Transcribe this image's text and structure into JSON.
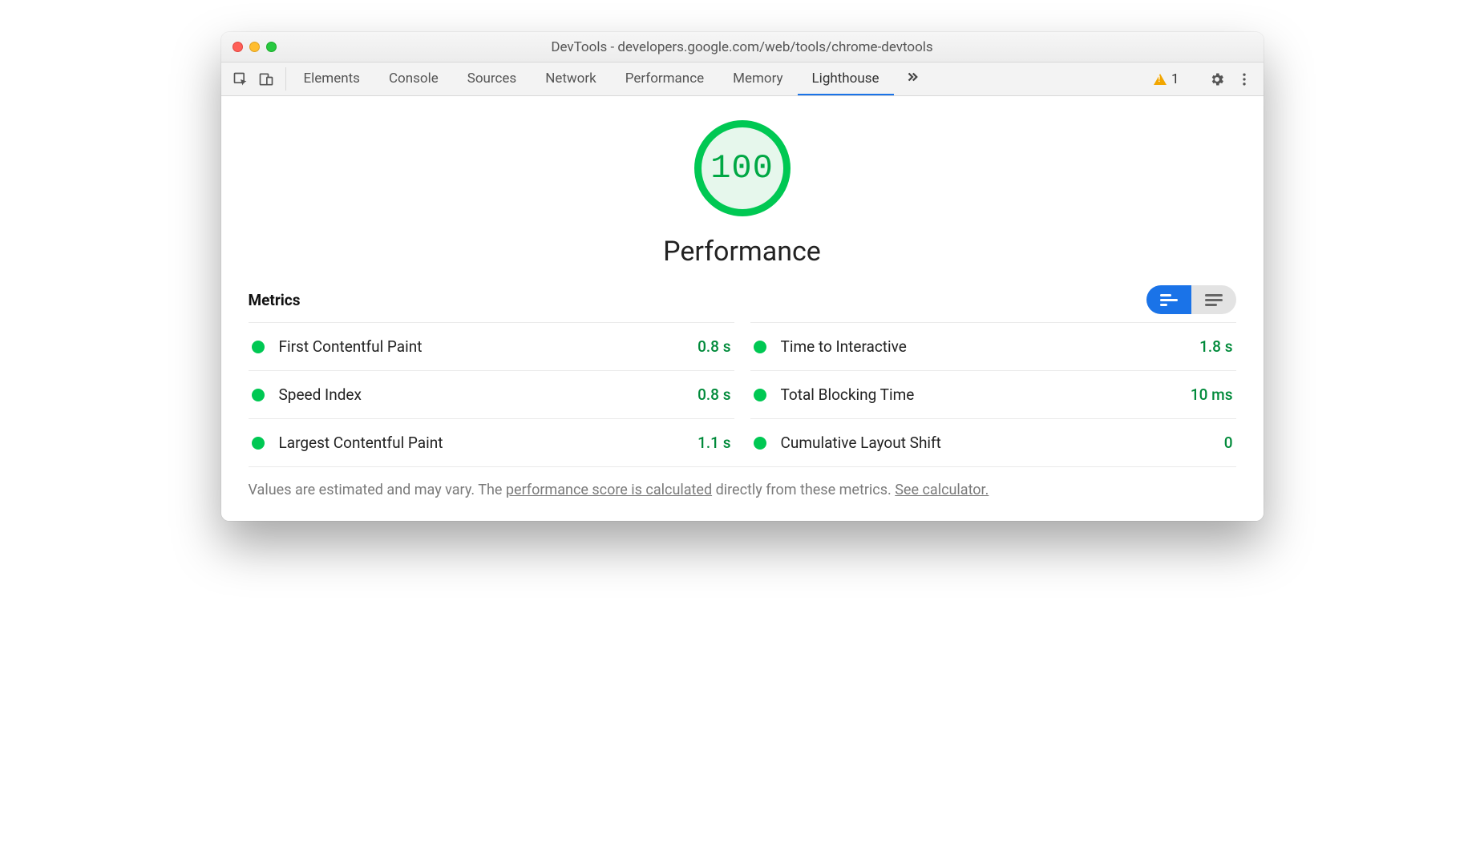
{
  "window": {
    "title": "DevTools - developers.google.com/web/tools/chrome-devtools"
  },
  "toolbar": {
    "tabs": [
      "Elements",
      "Console",
      "Sources",
      "Network",
      "Performance",
      "Memory",
      "Lighthouse"
    ],
    "active_tab_index": 6,
    "warning_count": "1"
  },
  "lighthouse": {
    "score": "100",
    "category": "Performance",
    "metrics_label": "Metrics",
    "metrics": [
      {
        "name": "First Contentful Paint",
        "value": "0.8 s"
      },
      {
        "name": "Time to Interactive",
        "value": "1.8 s"
      },
      {
        "name": "Speed Index",
        "value": "0.8 s"
      },
      {
        "name": "Total Blocking Time",
        "value": "10 ms"
      },
      {
        "name": "Largest Contentful Paint",
        "value": "1.1 s"
      },
      {
        "name": "Cumulative Layout Shift",
        "value": "0"
      }
    ],
    "footer": {
      "prefix": "Values are estimated and may vary. The ",
      "link1": "performance score is calculated",
      "middle": " directly from these metrics. ",
      "link2": "See calculator."
    }
  },
  "colors": {
    "accent_blue": "#1a73e8",
    "pass_green": "#00c853",
    "value_green": "#008a3a",
    "warning_orange": "#f2a600"
  }
}
